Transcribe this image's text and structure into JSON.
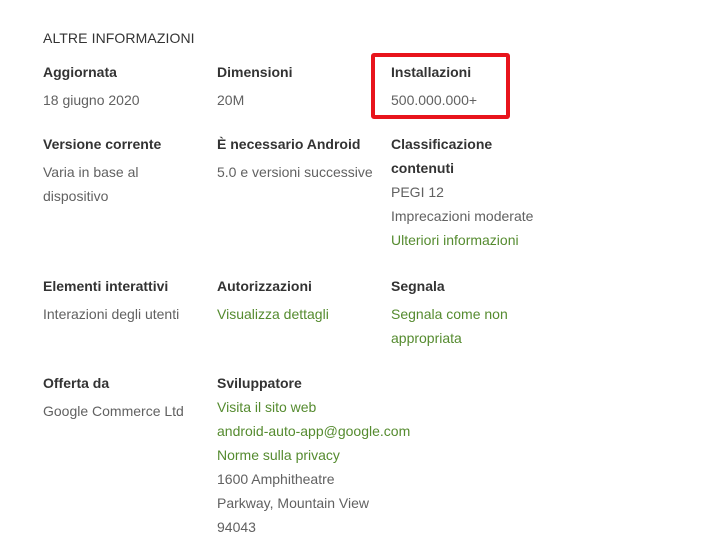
{
  "section_title": "ALTRE INFORMAZIONI",
  "updated": {
    "label": "Aggiornata",
    "value": "18 giugno 2020"
  },
  "size": {
    "label": "Dimensioni",
    "value": "20M"
  },
  "installs": {
    "label": "Installazioni",
    "value": "500.000.000+"
  },
  "current_version": {
    "label": "Versione corrente",
    "value_line1": "Varia in base al",
    "value_line2": "dispositivo"
  },
  "requires_android": {
    "label": "È necessario Android",
    "value": "5.0 e versioni successive"
  },
  "content_rating": {
    "label_line1": "Classificazione",
    "label_line2": "contenuti",
    "rating": "PEGI 12",
    "descriptor": "Imprecazioni moderate",
    "more_info_link": "Ulteriori informazioni"
  },
  "interactive_elements": {
    "label": "Elementi interattivi",
    "value": "Interazioni degli utenti"
  },
  "permissions": {
    "label": "Autorizzazioni",
    "link": "Visualizza dettagli"
  },
  "report": {
    "label": "Segnala",
    "link_line1": "Segnala come non",
    "link_line2": "appropriata"
  },
  "offered_by": {
    "label": "Offerta da",
    "value": "Google Commerce Ltd"
  },
  "developer": {
    "label": "Sviluppatore",
    "website_link": "Visita il sito web",
    "email_link": "android-auto-app@google.com",
    "privacy_link": "Norme sulla privacy",
    "address_line1": "1600 Amphitheatre",
    "address_line2": "Parkway, Mountain View",
    "address_line3": "94043"
  },
  "colors": {
    "link": "#558b2f",
    "highlight_border": "#e8141c",
    "label": "#333333",
    "value": "#616161"
  }
}
